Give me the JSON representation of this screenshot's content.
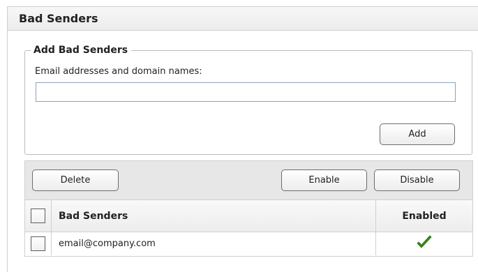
{
  "panel": {
    "title": "Bad Senders"
  },
  "add_section": {
    "legend": "Add Bad Senders",
    "field_label": "Email addresses and domain names:",
    "input_value": "",
    "input_placeholder": "",
    "add_label": "Add"
  },
  "toolbar": {
    "delete_label": "Delete",
    "enable_label": "Enable",
    "disable_label": "Disable"
  },
  "table": {
    "headers": {
      "name": "Bad Senders",
      "enabled": "Enabled"
    },
    "rows": [
      {
        "email": "email@company.com",
        "enabled": true,
        "enabled_icon": "checkmark-icon"
      }
    ]
  },
  "colors": {
    "check_green": "#3a8a1c",
    "input_border": "#8aa3bd"
  }
}
